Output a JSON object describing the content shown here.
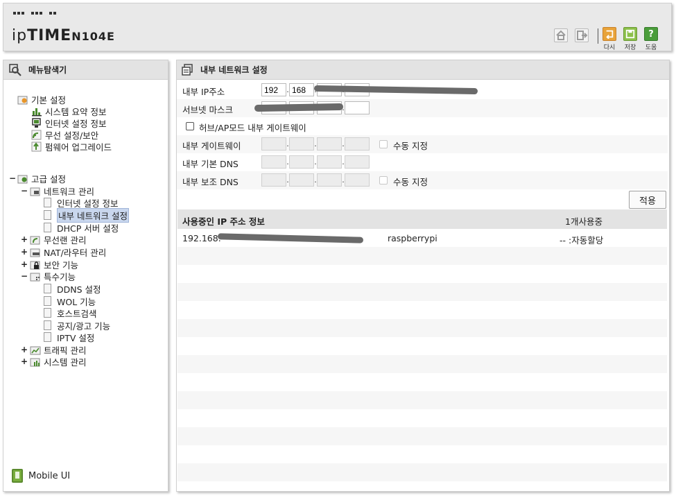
{
  "header": {
    "logo_ip": "ip",
    "logo_time": "TIME",
    "logo_model": "N104E",
    "restart_label": "다시",
    "save_label": "저장",
    "help_label": "도움"
  },
  "sidebar": {
    "title": "메뉴탐색기",
    "basic": {
      "label": "기본 설정",
      "items": [
        "시스템 요약 정보",
        "인터넷 설정 정보",
        "무선 설정/보안",
        "펌웨어 업그레이드"
      ]
    },
    "advanced": {
      "toggle": "−",
      "label": "고급 설정",
      "network": {
        "toggle": "−",
        "label": "네트워크 관리",
        "items": [
          "인터넷 설정 정보",
          "내부 네트워크 설정",
          "DHCP 서버 설정"
        ]
      },
      "wireless": {
        "toggle": "+",
        "label": "무선랜 관리"
      },
      "nat": {
        "toggle": "+",
        "label": "NAT/라우터 관리"
      },
      "security": {
        "toggle": "+",
        "label": "보안 기능"
      },
      "special": {
        "toggle": "−",
        "label": "특수기능",
        "items": [
          "DDNS 설정",
          "WOL 기능",
          "호스트검색",
          "공지/광고 기능",
          "IPTV 설정"
        ]
      },
      "traffic": {
        "toggle": "+",
        "label": "트래픽 관리"
      },
      "system": {
        "toggle": "+",
        "label": "시스템 관리"
      }
    },
    "mobile_label": "Mobile UI"
  },
  "main": {
    "title": "내부 네트워크 설정",
    "ip_label": "내부 IP주소",
    "ip_octet1": "192",
    "ip_octet2": "168",
    "subnet_label": "서브넷 마스크",
    "hub_mode_label": "허브/AP모드 내부 게이트웨이",
    "gateway_label": "내부 게이트웨이",
    "manual_label_1": "수동 지정",
    "dns1_label": "내부 기본 DNS",
    "dns2_label": "내부 보조 DNS",
    "manual_label_2": "수동 지정",
    "apply_label": "적용",
    "ip_list": {
      "title": "사용중인 IP 주소 정보",
      "count_label": "1개사용중",
      "rows": [
        {
          "ip": "192.168.",
          "hostname": "raspberrypi",
          "type": "-- :자동할당"
        }
      ]
    }
  },
  "colors": {
    "accent_selected": "#c9d7ee",
    "restart_button": "#e8a33a",
    "save_button": "#8cc04a",
    "help_button": "#4a9d3a"
  }
}
